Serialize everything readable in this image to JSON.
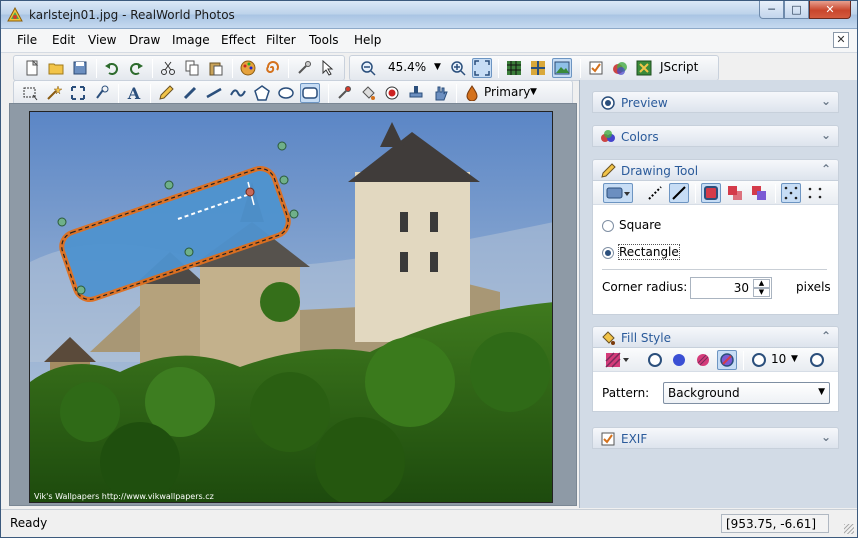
{
  "window": {
    "title": "karlstejn01.jpg - RealWorld Photos"
  },
  "menu": [
    "File",
    "Edit",
    "View",
    "Draw",
    "Image",
    "Effect",
    "Filter",
    "Tools",
    "Help"
  ],
  "toolbar": {
    "zoom": "45.4%",
    "script_label": "JScript",
    "color_label": "Primary"
  },
  "photo": {
    "credit": "Vik's Wallpapers   http://www.vikwallpapers.cz"
  },
  "panels": {
    "preview": {
      "title": "Preview"
    },
    "colors": {
      "title": "Colors"
    },
    "drawing": {
      "title": "Drawing Tool",
      "shape_square": "Square",
      "shape_rectangle": "Rectangle",
      "corner_label": "Corner radius:",
      "corner_value": "30",
      "corner_unit": "pixels"
    },
    "fill": {
      "title": "Fill Style",
      "width_value": "10",
      "pattern_label": "Pattern:",
      "pattern_value": "Background"
    },
    "exif": {
      "title": "EXIF"
    }
  },
  "status": {
    "text": "Ready",
    "coords": "[953.75, -6.61]"
  },
  "colors": {
    "accent": "#2a5a9a",
    "shape_fill": "#4f93cf",
    "shape_border": "#e0701f"
  }
}
